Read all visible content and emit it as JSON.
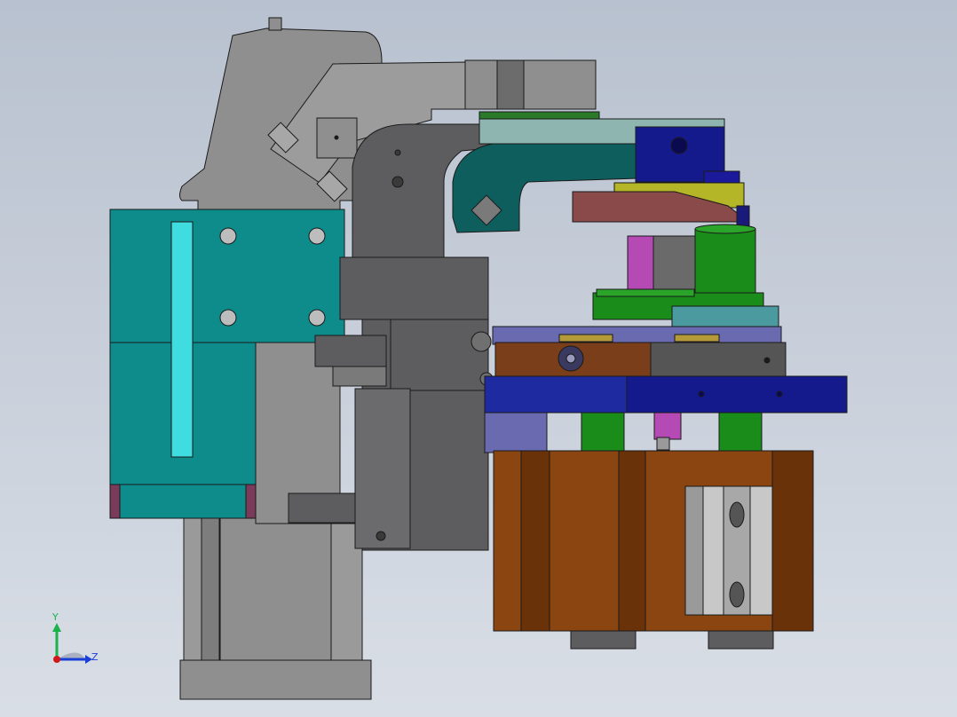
{
  "viewport": {
    "background_top": "#b8c1cf",
    "background_bottom": "#d9dee6"
  },
  "model": {
    "colors": {
      "gray_body": "#8f8f8f",
      "gray_dark": "#5d5d60",
      "gray_light": "#a7a7a7",
      "teal": "#0e8c8c",
      "teal_light": "#3fdde0",
      "dark_teal": "#0f5e5e",
      "navy": "#141a8c",
      "blue_plate": "#1e2ba0",
      "orange_block": "#8a4510",
      "brown_plate": "#7a3e1a",
      "maroon": "#8b4a4a",
      "green": "#1a8c1a",
      "magenta": "#b54ab5",
      "yellow_olive": "#b5b528",
      "slate_blue": "#6a6ab0",
      "steel": "#7f8a96"
    }
  },
  "triad": {
    "y_label": "Y",
    "z_label": "Z",
    "y_color": "#19b34d",
    "z_color": "#1a3fd6",
    "x_color": "#d01818"
  }
}
